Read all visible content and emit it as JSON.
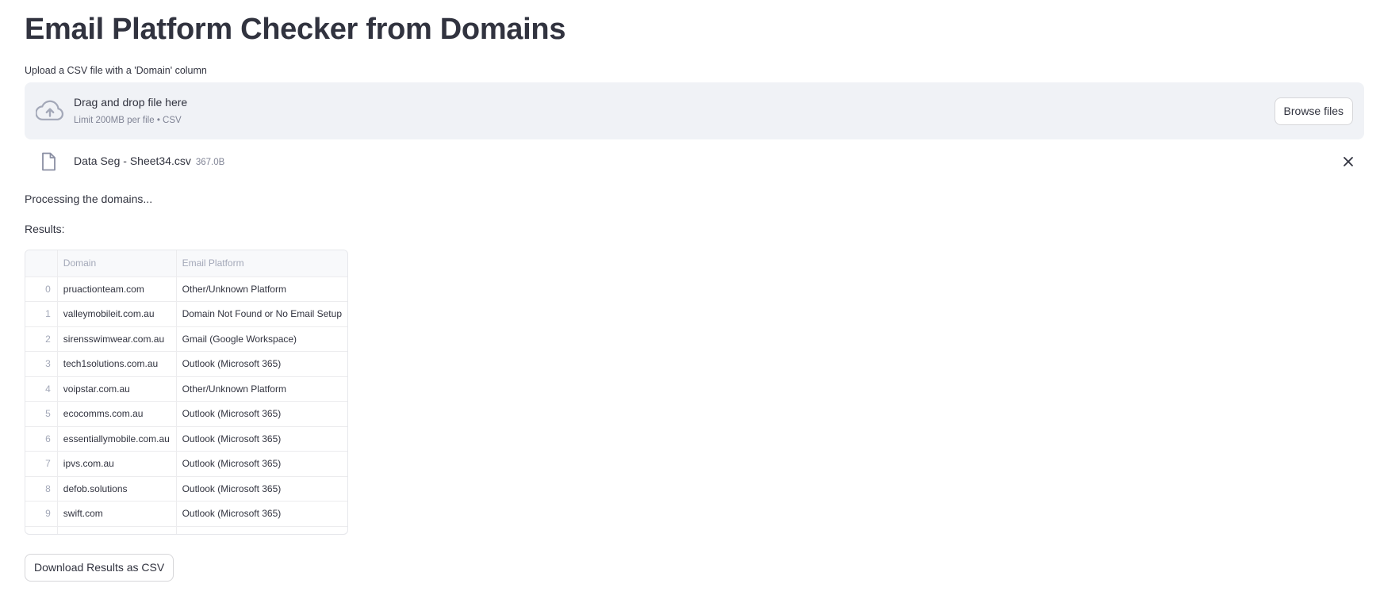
{
  "page": {
    "title": "Email Platform Checker from Domains"
  },
  "uploader": {
    "label": "Upload a CSV file with a 'Domain' column",
    "drop_text": "Drag and drop file here",
    "limit_text": "Limit 200MB per file • CSV",
    "browse_label": "Browse files",
    "icon": "cloud-upload-icon"
  },
  "uploaded_file": {
    "name": "Data Seg - Sheet34.csv",
    "size": "367.0B",
    "icon": "file-icon",
    "remove_icon": "close-icon"
  },
  "status": {
    "processing": "Processing the domains...",
    "results_label": "Results:"
  },
  "table": {
    "columns": [
      "",
      "Domain",
      "Email Platform"
    ],
    "rows": [
      {
        "index": "0",
        "domain": "pruactionteam.com",
        "platform": "Other/Unknown Platform"
      },
      {
        "index": "1",
        "domain": "valleymobileit.com.au",
        "platform": "Domain Not Found or No Email Setup"
      },
      {
        "index": "2",
        "domain": "sirensswimwear.com.au",
        "platform": "Gmail (Google Workspace)"
      },
      {
        "index": "3",
        "domain": "tech1solutions.com.au",
        "platform": "Outlook (Microsoft 365)"
      },
      {
        "index": "4",
        "domain": "voipstar.com.au",
        "platform": "Other/Unknown Platform"
      },
      {
        "index": "5",
        "domain": "ecocomms.com.au",
        "platform": "Outlook (Microsoft 365)"
      },
      {
        "index": "6",
        "domain": "essentiallymobile.com.au",
        "platform": "Outlook (Microsoft 365)"
      },
      {
        "index": "7",
        "domain": "ipvs.com.au",
        "platform": "Outlook (Microsoft 365)"
      },
      {
        "index": "8",
        "domain": "defob.solutions",
        "platform": "Outlook (Microsoft 365)"
      },
      {
        "index": "9",
        "domain": "swift.com",
        "platform": "Outlook (Microsoft 365)"
      }
    ]
  },
  "download": {
    "label": "Download Results as CSV"
  },
  "colors": {
    "text": "#31333f",
    "muted": "#808495",
    "dropzone_bg": "#f0f2f6",
    "border": "#d6d6d9"
  }
}
